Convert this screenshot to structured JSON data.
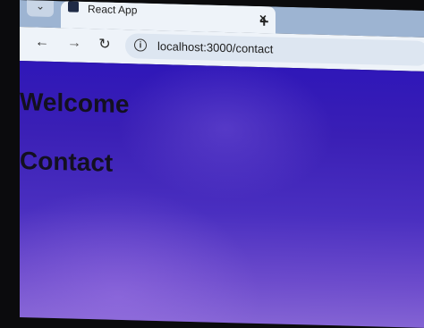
{
  "browser": {
    "tab": {
      "title": "React App",
      "close_glyph": "×"
    },
    "new_tab_glyph": "+",
    "menu_glyph": "⌄",
    "nav": {
      "back_glyph": "←",
      "forward_glyph": "→",
      "reload_glyph": "↻"
    },
    "omnibox": {
      "info_glyph": "i",
      "url": "localhost:3000/contact"
    }
  },
  "page": {
    "welcome_heading": "Welcome",
    "contact_heading": "Contact"
  },
  "colors": {
    "page_background_top": "#2f17b8",
    "page_background_bottom": "#8a6ad6",
    "heading_text": "#131020",
    "tabstrip": "#9db4d2",
    "toolbar": "#eef3f9"
  }
}
